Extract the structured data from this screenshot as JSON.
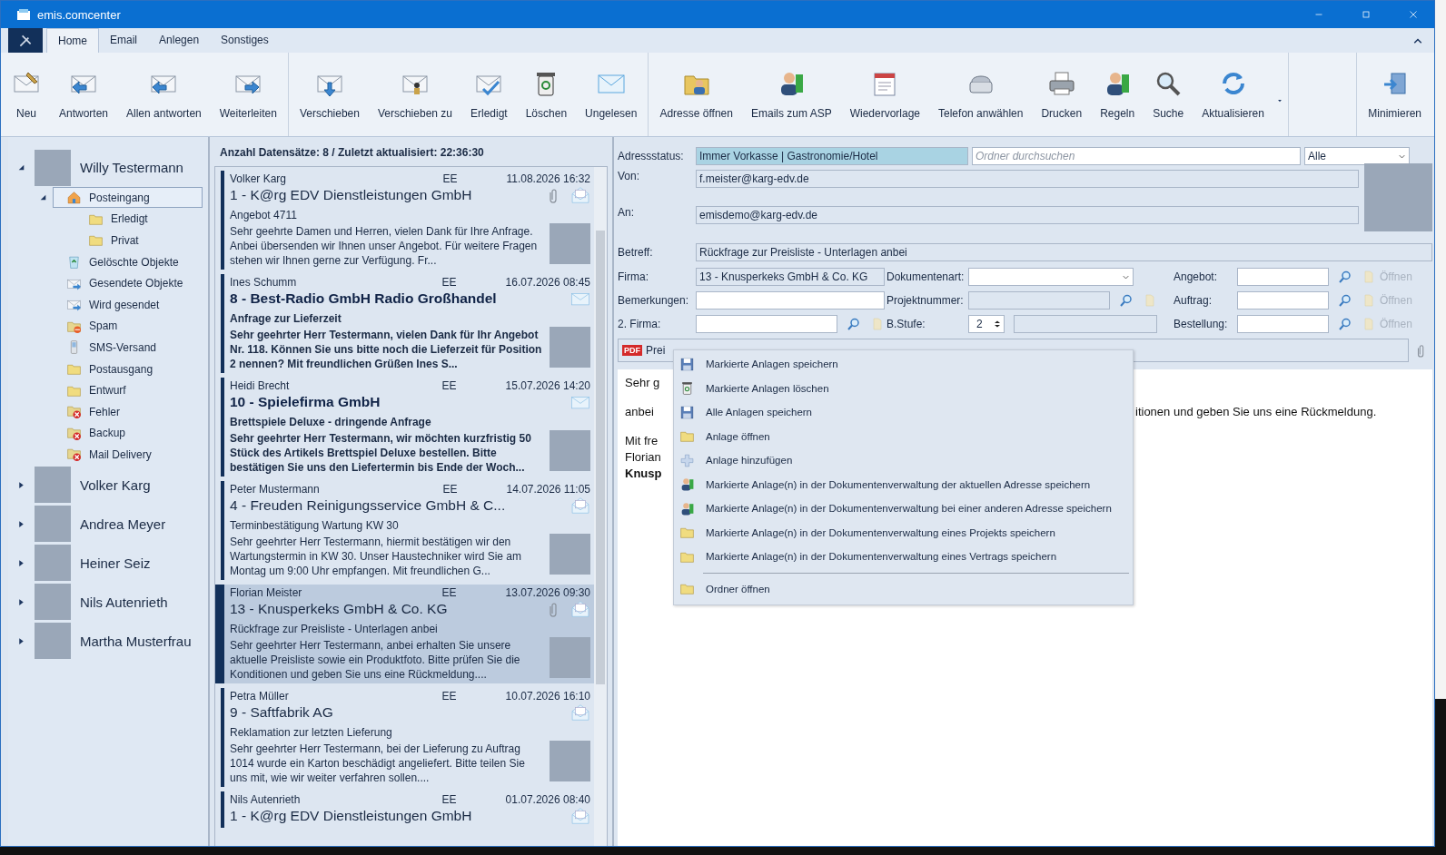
{
  "window": {
    "title": "emis.comcenter"
  },
  "ribbon_tabs": [
    {
      "label": "Home",
      "selected": true
    },
    {
      "label": "Email",
      "selected": false
    },
    {
      "label": "Anlegen",
      "selected": false
    },
    {
      "label": "Sonstiges",
      "selected": false
    }
  ],
  "toolbar_groups": [
    [
      {
        "label": "Neu",
        "kind": "new"
      },
      {
        "label": "Antworten",
        "kind": "reply"
      },
      {
        "label": "Allen antworten",
        "kind": "reply"
      },
      {
        "label": "Weiterleiten",
        "kind": "forward"
      }
    ],
    [
      {
        "label": "Verschieben",
        "kind": "move"
      },
      {
        "label": "Verschieben zu",
        "kind": "moveto"
      },
      {
        "label": "Erledigt",
        "kind": "done"
      },
      {
        "label": "Löschen",
        "kind": "trash"
      },
      {
        "label": "Ungelesen",
        "kind": "mail"
      }
    ],
    [
      {
        "label": "Adresse öffnen",
        "kind": "address"
      },
      {
        "label": "Emails zum ASP",
        "kind": "person"
      },
      {
        "label": "Wiedervorlage",
        "kind": "calendar"
      },
      {
        "label": "Telefon anwählen",
        "kind": "phone"
      },
      {
        "label": "Drucken",
        "kind": "printer"
      },
      {
        "label": "Regeln",
        "kind": "person"
      },
      {
        "label": "Suche",
        "kind": "search"
      },
      {
        "label": "Aktualisieren",
        "kind": "refresh"
      },
      {
        "kind": "more"
      }
    ],
    [
      {
        "label": "Minimieren",
        "kind": "minimize"
      }
    ]
  ],
  "tree": [
    {
      "name": "Willy Testermann",
      "expanded": true,
      "children": [
        {
          "label": "Posteingang",
          "kind": "inbox",
          "selected": true,
          "expanded": true,
          "children": [
            {
              "label": "Erledigt",
              "kind": "folder",
              "selected": false
            },
            {
              "label": "Privat",
              "kind": "folder",
              "selected": false
            }
          ]
        },
        {
          "label": "Gelöschte Objekte",
          "kind": "bin",
          "selected": false
        },
        {
          "label": "Gesendete Objekte",
          "kind": "sent",
          "selected": false
        },
        {
          "label": "Wird gesendet",
          "kind": "sent",
          "selected": false
        },
        {
          "label": "Spam",
          "kind": "blocked",
          "selected": false
        },
        {
          "label": "SMS-Versand",
          "kind": "mobile",
          "selected": false
        },
        {
          "label": "Postausgang",
          "kind": "folder",
          "selected": false
        },
        {
          "label": "Entwurf",
          "kind": "folder",
          "selected": false
        },
        {
          "label": "Fehler",
          "kind": "error",
          "selected": false
        },
        {
          "label": "Backup",
          "kind": "error",
          "selected": false
        },
        {
          "label": "Mail Delivery",
          "kind": "error",
          "selected": false
        }
      ]
    },
    {
      "name": "Volker Karg",
      "expanded": false
    },
    {
      "name": "Andrea Meyer",
      "expanded": false
    },
    {
      "name": "Heiner Seiz",
      "expanded": false
    },
    {
      "name": "Nils Autenrieth",
      "expanded": false
    },
    {
      "name": "Martha Musterfrau",
      "expanded": false
    }
  ],
  "message_list": {
    "header": "Anzahl Datensätze: 8 / Zuletzt aktualisiert: 22:36:30",
    "messages": [
      {
        "sender": "Volker Karg",
        "code": "EE",
        "date": "11.08.2026 16:32",
        "title": "1 - K@rg EDV Dienstleistungen GmbH",
        "subject": "Angebot 4711",
        "preview": "Sehr geehrte Damen und Herren,  vielen Dank für Ihre Anfrage. Anbei übersenden wir Ihnen unser Angebot. Für weitere Fragen stehen wir Ihnen gerne zur Verfügung.  Fr...",
        "unread": false,
        "has_attachment": true,
        "selected": false
      },
      {
        "sender": "Ines Schumm",
        "code": "EE",
        "date": "16.07.2026 08:45",
        "title": "8 - Best-Radio GmbH Radio Großhandel",
        "subject": "Anfrage zur Lieferzeit",
        "preview": "Sehr geehrter Herr Testermann,  vielen Dank für Ihr Angebot Nr. 118. Können Sie uns bitte noch die Lieferzeit für Position 2 nennen?  Mit freundlichen Grüßen Ines S...",
        "unread": true,
        "has_attachment": false,
        "selected": false
      },
      {
        "sender": "Heidi Brecht",
        "code": "EE",
        "date": "15.07.2026 14:20",
        "title": "10 - Spielefirma GmbH",
        "subject": "Brettspiele Deluxe - dringende Anfrage",
        "preview": "Sehr geehrter Herr Testermann,  wir möchten kurzfristig 50 Stück des Artikels Brettspiel Deluxe bestellen. Bitte bestätigen Sie uns den Liefertermin bis Ende der Woch...",
        "unread": true,
        "has_attachment": false,
        "selected": false
      },
      {
        "sender": "Peter Mustermann",
        "code": "EE",
        "date": "14.07.2026 11:05",
        "title": "4 - Freuden Reinigungsservice GmbH & C...",
        "subject": "Terminbestätigung Wartung KW 30",
        "preview": "Sehr geehrter Herr Testermann,  hiermit bestätigen wir den Wartungstermin in KW 30. Unser Haustechniker wird Sie am Montag um 9:00 Uhr empfangen.  Mit freundlichen G...",
        "unread": false,
        "has_attachment": false,
        "selected": false
      },
      {
        "sender": "Florian Meister",
        "code": "EE",
        "date": "13.07.2026 09:30",
        "title": "13 - Knusperkeks GmbH & Co. KG",
        "subject": "Rückfrage zur Preisliste - Unterlagen anbei",
        "preview": "Sehr geehrter Herr Testermann,  anbei erhalten Sie unsere aktuelle Preisliste sowie ein Produktfoto. Bitte prüfen Sie die Konditionen und geben Sie uns eine Rückmeldung....",
        "unread": false,
        "has_attachment": true,
        "selected": true
      },
      {
        "sender": "Petra Müller",
        "code": "EE",
        "date": "10.07.2026 16:10",
        "title": "9 - Saftfabrik AG",
        "subject": "Reklamation zur letzten Lieferung",
        "preview": "Sehr geehrter Herr Testermann,  bei der Lieferung zu Auftrag 1014 wurde ein Karton beschädigt angeliefert. Bitte teilen Sie uns mit, wie wir weiter verfahren sollen....",
        "unread": false,
        "has_attachment": false,
        "selected": false
      },
      {
        "sender": "Nils Autenrieth",
        "code": "EE",
        "date": "01.07.2026 08:40",
        "title": "1 - K@rg EDV Dienstleistungen GmbH",
        "unread": false,
        "has_attachment": false,
        "selected": false
      }
    ]
  },
  "reading_pane": {
    "address_status": {
      "label": "Adressstatus:",
      "value": "Immer Vorkasse | Gastronomie/Hotel"
    },
    "folder_search": {
      "placeholder": "Ordner durchsuchen"
    },
    "filter": {
      "value": "Alle"
    },
    "from": {
      "label": "Von:",
      "value": "f.meister@karg-edv.de"
    },
    "to": {
      "label": "An:",
      "value": "emisdemo@karg-edv.de"
    },
    "subject": {
      "label": "Betreff:",
      "value": "Rückfrage zur Preisliste - Unterlagen anbei"
    },
    "company": {
      "label": "Firma:",
      "value": "13 - Knusperkeks GmbH & Co. KG"
    },
    "remarks": {
      "label": "Bemerkungen:"
    },
    "company_2": {
      "label": "2. Firma:"
    },
    "document_type": {
      "label": "Dokumentenart:"
    },
    "project_number": {
      "label": "Projektnummer:"
    },
    "level_field": {
      "label": "B.Stufe:",
      "value": "2"
    },
    "links": [
      {
        "label": "Angebot:",
        "action": "Öffnen",
        "disabled": true
      },
      {
        "label": "Auftrag:",
        "action": "Öffnen",
        "disabled": true
      },
      {
        "label": "Bestellung:",
        "action": "Öffnen",
        "disabled": true
      }
    ],
    "attachments": [
      {
        "name": "Prei",
        "badge": "PDF"
      }
    ],
    "body": [
      [
        {
          "text": "Sehr g"
        }
      ],
      [
        {
          "text": "anbei",
          "text_right": "itionen und geben Sie uns eine Rückmeldung."
        }
      ],
      [
        {
          "text": "Mit fre"
        },
        {
          "text": "Florian"
        },
        {
          "text": "Knusp",
          "bold": true
        }
      ]
    ]
  },
  "context_menu": {
    "items": [
      {
        "label": "Markierte Anlagen speichern",
        "kind": "save"
      },
      {
        "label": "Markierte Anlagen löschen",
        "kind": "trash"
      },
      {
        "label": "Alle Anlagen speichern",
        "kind": "save"
      },
      {
        "label": "Anlage öffnen",
        "kind": "folder"
      },
      {
        "label": "Anlage hinzufügen",
        "kind": "add"
      },
      {
        "label": "Markierte Anlage(n) in der Dokumentenverwaltung der aktuellen Adresse speichern",
        "kind": "person"
      },
      {
        "label": "Markierte Anlage(n) in der Dokumentenverwaltung bei einer anderen Adresse speichern",
        "kind": "person"
      },
      {
        "label": "Markierte Anlage(n) in der Dokumentenverwaltung eines Projekts speichern",
        "kind": "folder"
      },
      {
        "label": "Markierte Anlage(n) in der Dokumentenverwaltung eines Vertrags speichern",
        "kind": "folder"
      },
      {
        "kind": "separator"
      },
      {
        "label": "Ordner öffnen",
        "kind": "folder"
      }
    ]
  }
}
